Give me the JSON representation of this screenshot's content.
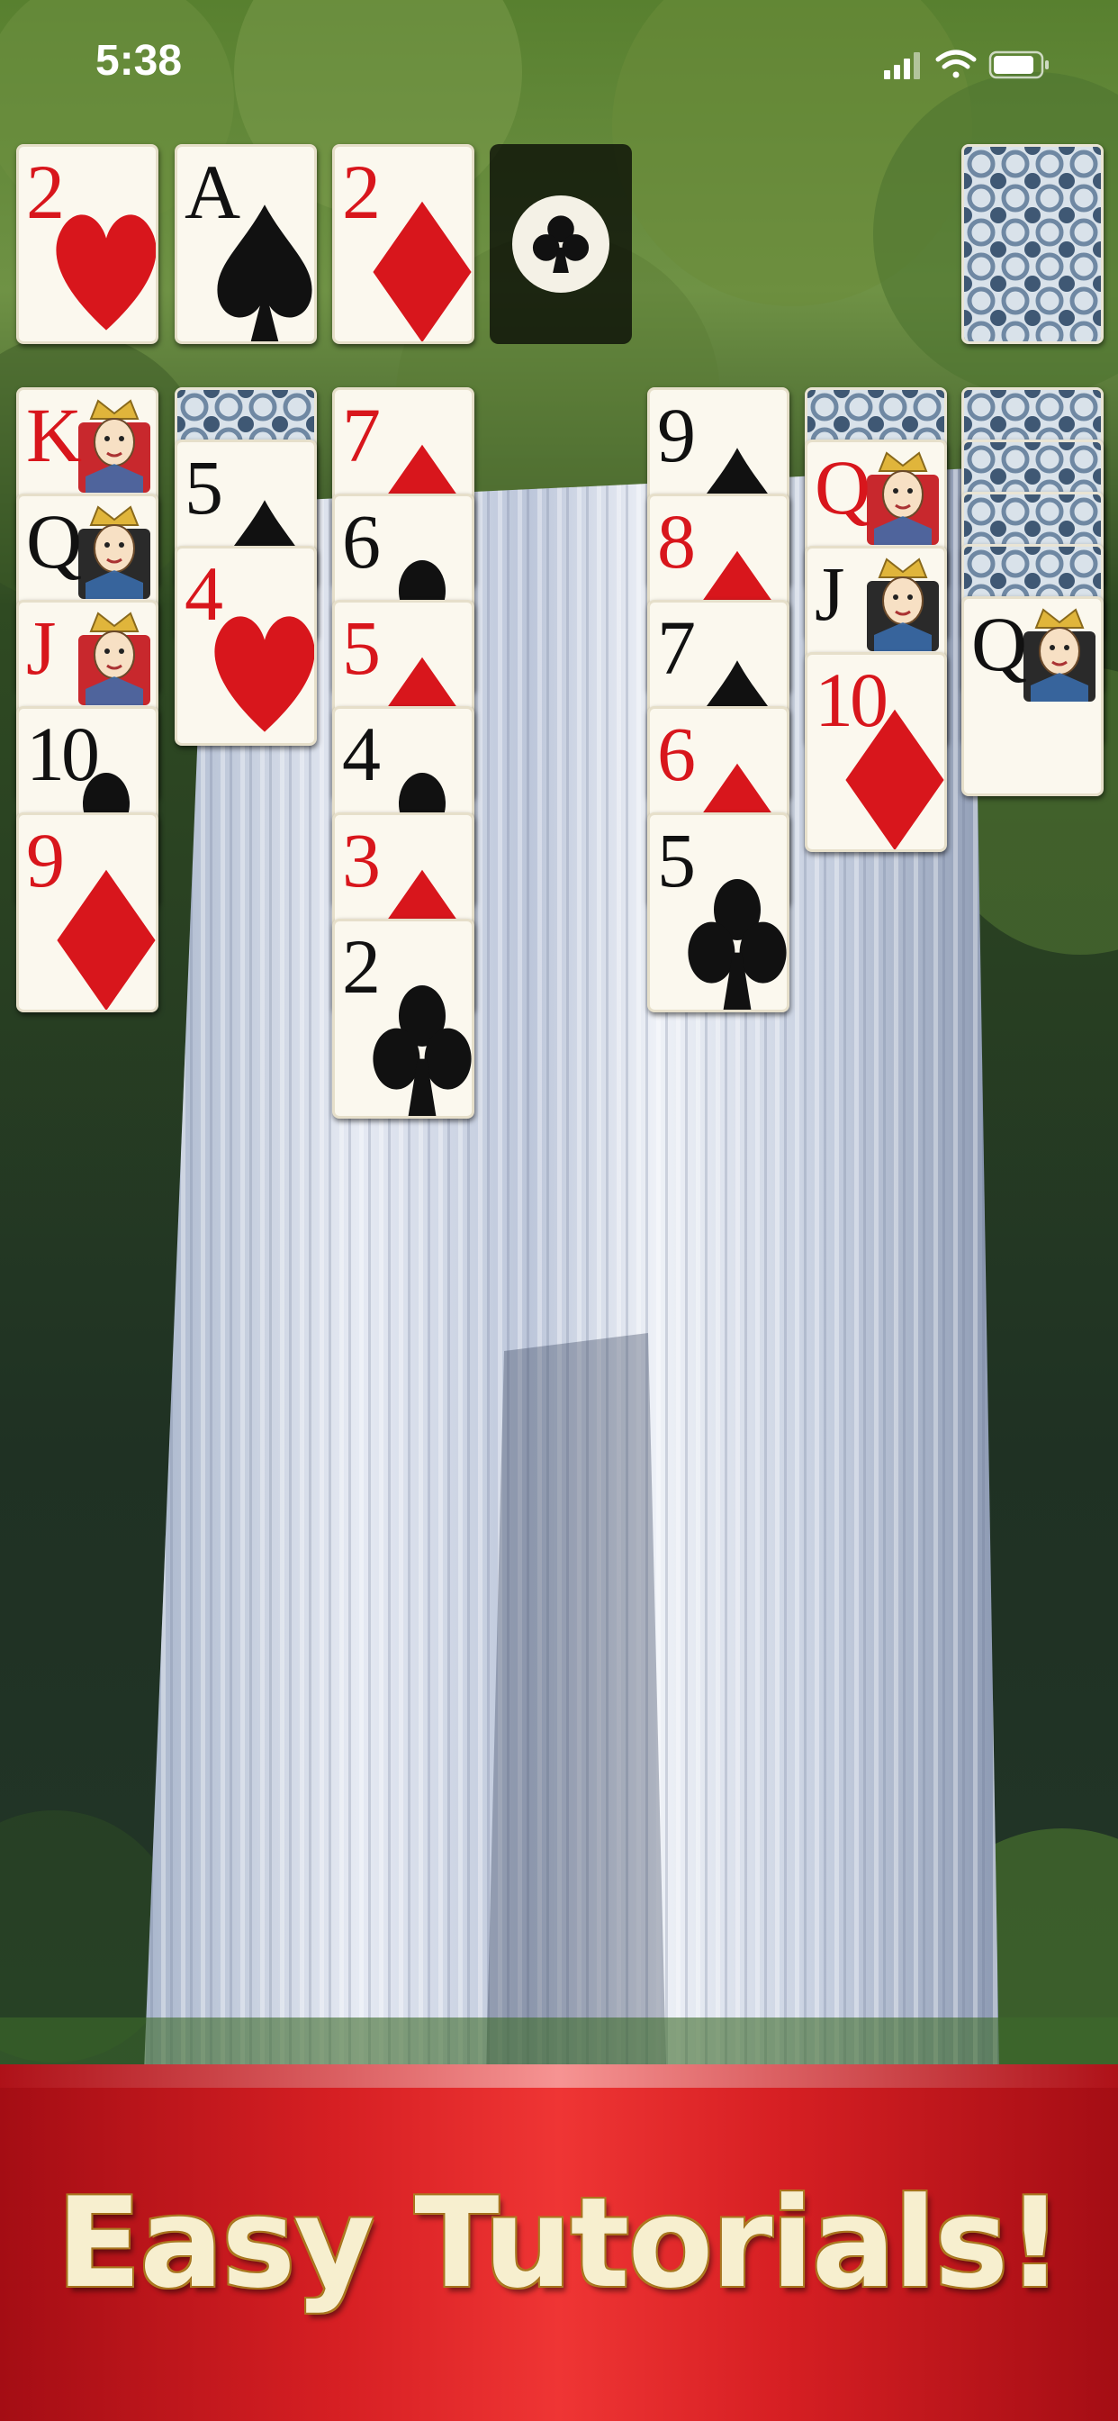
{
  "status_bar": {
    "time": "5:38",
    "icons": [
      "cellular-signal-icon",
      "wifi-icon",
      "battery-icon"
    ]
  },
  "theme": {
    "red": "#d8161c",
    "black": "#111111",
    "card_face": "#fbf8ee",
    "card_back": "#9eb3c8",
    "banner_red": "#d61f23",
    "banner_text": "#f7efcf"
  },
  "foundations": [
    {
      "rank": "2",
      "suit": "hearts",
      "color": "red"
    },
    {
      "rank": "A",
      "suit": "spades",
      "color": "black"
    },
    {
      "rank": "2",
      "suit": "diamonds",
      "color": "red"
    },
    {
      "empty": true,
      "suit": "clubs"
    }
  ],
  "stock": {
    "face_down": true
  },
  "tableau": [
    {
      "hidden": 0,
      "cards": [
        {
          "rank": "K",
          "suit": "hearts",
          "color": "red"
        },
        {
          "rank": "Q",
          "suit": "spades",
          "color": "black"
        },
        {
          "rank": "J",
          "suit": "hearts",
          "color": "red"
        },
        {
          "rank": "10",
          "suit": "clubs",
          "color": "black"
        },
        {
          "rank": "9",
          "suit": "diamonds",
          "color": "red"
        }
      ]
    },
    {
      "hidden": 1,
      "cards": [
        {
          "rank": "5",
          "suit": "spades",
          "color": "black"
        },
        {
          "rank": "4",
          "suit": "hearts",
          "color": "red"
        }
      ]
    },
    {
      "hidden": 0,
      "cards": [
        {
          "rank": "7",
          "suit": "diamonds",
          "color": "red"
        },
        {
          "rank": "6",
          "suit": "clubs",
          "color": "black"
        },
        {
          "rank": "5",
          "suit": "diamonds",
          "color": "red"
        },
        {
          "rank": "4",
          "suit": "clubs",
          "color": "black"
        },
        {
          "rank": "3",
          "suit": "diamonds",
          "color": "red"
        },
        {
          "rank": "2",
          "suit": "clubs",
          "color": "black"
        }
      ]
    },
    {
      "hidden": 0,
      "cards": []
    },
    {
      "hidden": 0,
      "cards": [
        {
          "rank": "9",
          "suit": "spades",
          "color": "black"
        },
        {
          "rank": "8",
          "suit": "diamonds",
          "color": "red"
        },
        {
          "rank": "7",
          "suit": "spades",
          "color": "black"
        },
        {
          "rank": "6",
          "suit": "diamonds",
          "color": "red"
        },
        {
          "rank": "5",
          "suit": "clubs",
          "color": "black"
        }
      ]
    },
    {
      "hidden": 1,
      "cards": [
        {
          "rank": "Q",
          "suit": "hearts",
          "color": "red"
        },
        {
          "rank": "J",
          "suit": "spades",
          "color": "black"
        },
        {
          "rank": "10",
          "suit": "diamonds",
          "color": "red"
        }
      ]
    },
    {
      "hidden": 4,
      "cards": [
        {
          "rank": "Q",
          "suit": "clubs",
          "color": "black"
        }
      ]
    }
  ],
  "banner": {
    "text": "Easy Tutorials!"
  }
}
